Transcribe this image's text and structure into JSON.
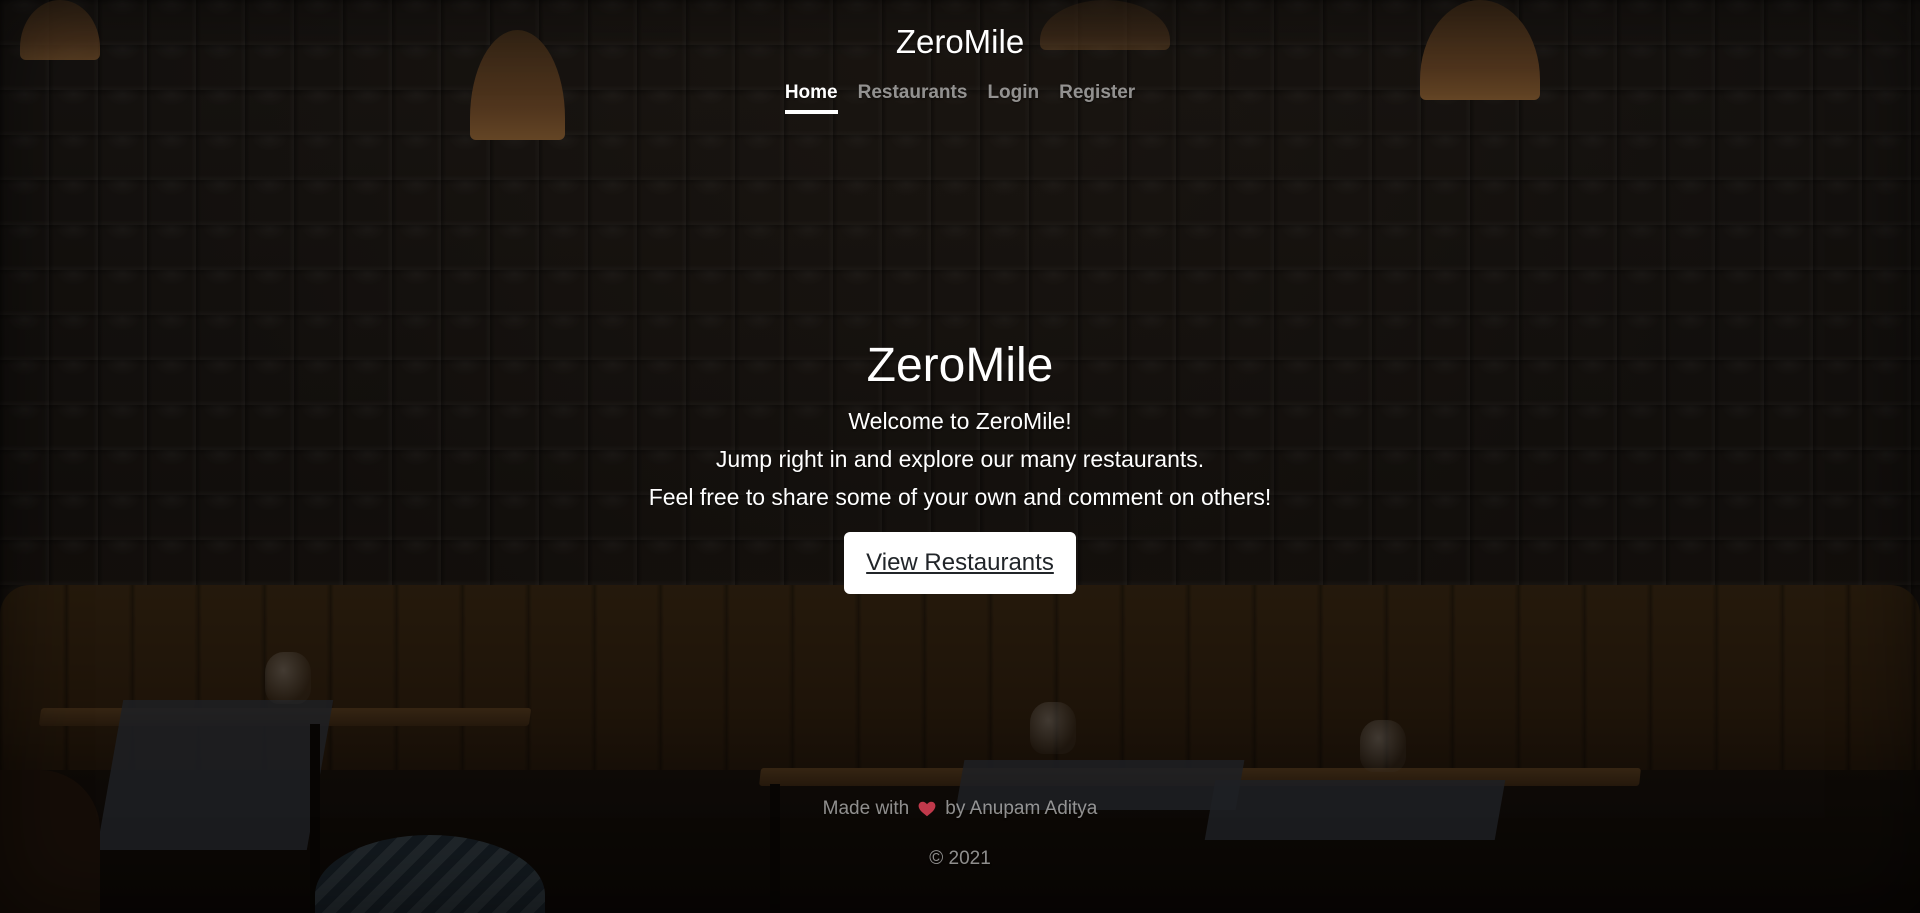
{
  "brand": "ZeroMile",
  "nav": {
    "items": [
      {
        "label": "Home",
        "active": true
      },
      {
        "label": "Restaurants",
        "active": false
      },
      {
        "label": "Login",
        "active": false
      },
      {
        "label": "Register",
        "active": false
      }
    ]
  },
  "hero": {
    "title": "ZeroMile",
    "lines": [
      "Welcome to ZeroMile!",
      "Jump right in and explore our many restaurants.",
      "Feel free to share some of your own and comment on others!"
    ],
    "cta_label": "View Restaurants"
  },
  "footer": {
    "made_with": "Made with",
    "heart_icon": "heart-icon",
    "by": "by Anupam Aditya",
    "copyright": "© 2021"
  },
  "colors": {
    "heart": "#c0394b",
    "nav_active": "#ffffff",
    "nav_inactive": "rgba(255,255,255,0.55)"
  }
}
